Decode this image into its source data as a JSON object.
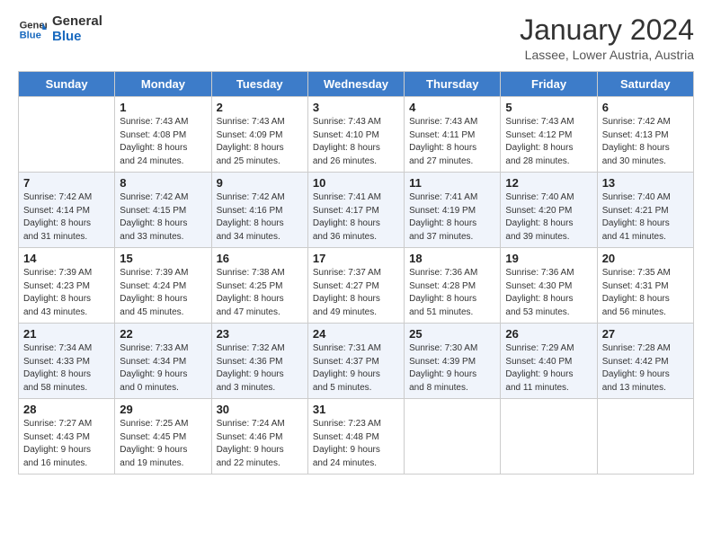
{
  "logo": {
    "line1": "General",
    "line2": "Blue"
  },
  "header": {
    "month": "January 2024",
    "location": "Lassee, Lower Austria, Austria"
  },
  "weekdays": [
    "Sunday",
    "Monday",
    "Tuesday",
    "Wednesday",
    "Thursday",
    "Friday",
    "Saturday"
  ],
  "weeks": [
    [
      {
        "day": "",
        "info": ""
      },
      {
        "day": "1",
        "info": "Sunrise: 7:43 AM\nSunset: 4:08 PM\nDaylight: 8 hours\nand 24 minutes."
      },
      {
        "day": "2",
        "info": "Sunrise: 7:43 AM\nSunset: 4:09 PM\nDaylight: 8 hours\nand 25 minutes."
      },
      {
        "day": "3",
        "info": "Sunrise: 7:43 AM\nSunset: 4:10 PM\nDaylight: 8 hours\nand 26 minutes."
      },
      {
        "day": "4",
        "info": "Sunrise: 7:43 AM\nSunset: 4:11 PM\nDaylight: 8 hours\nand 27 minutes."
      },
      {
        "day": "5",
        "info": "Sunrise: 7:43 AM\nSunset: 4:12 PM\nDaylight: 8 hours\nand 28 minutes."
      },
      {
        "day": "6",
        "info": "Sunrise: 7:42 AM\nSunset: 4:13 PM\nDaylight: 8 hours\nand 30 minutes."
      }
    ],
    [
      {
        "day": "7",
        "info": "Sunrise: 7:42 AM\nSunset: 4:14 PM\nDaylight: 8 hours\nand 31 minutes."
      },
      {
        "day": "8",
        "info": "Sunrise: 7:42 AM\nSunset: 4:15 PM\nDaylight: 8 hours\nand 33 minutes."
      },
      {
        "day": "9",
        "info": "Sunrise: 7:42 AM\nSunset: 4:16 PM\nDaylight: 8 hours\nand 34 minutes."
      },
      {
        "day": "10",
        "info": "Sunrise: 7:41 AM\nSunset: 4:17 PM\nDaylight: 8 hours\nand 36 minutes."
      },
      {
        "day": "11",
        "info": "Sunrise: 7:41 AM\nSunset: 4:19 PM\nDaylight: 8 hours\nand 37 minutes."
      },
      {
        "day": "12",
        "info": "Sunrise: 7:40 AM\nSunset: 4:20 PM\nDaylight: 8 hours\nand 39 minutes."
      },
      {
        "day": "13",
        "info": "Sunrise: 7:40 AM\nSunset: 4:21 PM\nDaylight: 8 hours\nand 41 minutes."
      }
    ],
    [
      {
        "day": "14",
        "info": "Sunrise: 7:39 AM\nSunset: 4:23 PM\nDaylight: 8 hours\nand 43 minutes."
      },
      {
        "day": "15",
        "info": "Sunrise: 7:39 AM\nSunset: 4:24 PM\nDaylight: 8 hours\nand 45 minutes."
      },
      {
        "day": "16",
        "info": "Sunrise: 7:38 AM\nSunset: 4:25 PM\nDaylight: 8 hours\nand 47 minutes."
      },
      {
        "day": "17",
        "info": "Sunrise: 7:37 AM\nSunset: 4:27 PM\nDaylight: 8 hours\nand 49 minutes."
      },
      {
        "day": "18",
        "info": "Sunrise: 7:36 AM\nSunset: 4:28 PM\nDaylight: 8 hours\nand 51 minutes."
      },
      {
        "day": "19",
        "info": "Sunrise: 7:36 AM\nSunset: 4:30 PM\nDaylight: 8 hours\nand 53 minutes."
      },
      {
        "day": "20",
        "info": "Sunrise: 7:35 AM\nSunset: 4:31 PM\nDaylight: 8 hours\nand 56 minutes."
      }
    ],
    [
      {
        "day": "21",
        "info": "Sunrise: 7:34 AM\nSunset: 4:33 PM\nDaylight: 8 hours\nand 58 minutes."
      },
      {
        "day": "22",
        "info": "Sunrise: 7:33 AM\nSunset: 4:34 PM\nDaylight: 9 hours\nand 0 minutes."
      },
      {
        "day": "23",
        "info": "Sunrise: 7:32 AM\nSunset: 4:36 PM\nDaylight: 9 hours\nand 3 minutes."
      },
      {
        "day": "24",
        "info": "Sunrise: 7:31 AM\nSunset: 4:37 PM\nDaylight: 9 hours\nand 5 minutes."
      },
      {
        "day": "25",
        "info": "Sunrise: 7:30 AM\nSunset: 4:39 PM\nDaylight: 9 hours\nand 8 minutes."
      },
      {
        "day": "26",
        "info": "Sunrise: 7:29 AM\nSunset: 4:40 PM\nDaylight: 9 hours\nand 11 minutes."
      },
      {
        "day": "27",
        "info": "Sunrise: 7:28 AM\nSunset: 4:42 PM\nDaylight: 9 hours\nand 13 minutes."
      }
    ],
    [
      {
        "day": "28",
        "info": "Sunrise: 7:27 AM\nSunset: 4:43 PM\nDaylight: 9 hours\nand 16 minutes."
      },
      {
        "day": "29",
        "info": "Sunrise: 7:25 AM\nSunset: 4:45 PM\nDaylight: 9 hours\nand 19 minutes."
      },
      {
        "day": "30",
        "info": "Sunrise: 7:24 AM\nSunset: 4:46 PM\nDaylight: 9 hours\nand 22 minutes."
      },
      {
        "day": "31",
        "info": "Sunrise: 7:23 AM\nSunset: 4:48 PM\nDaylight: 9 hours\nand 24 minutes."
      },
      {
        "day": "",
        "info": ""
      },
      {
        "day": "",
        "info": ""
      },
      {
        "day": "",
        "info": ""
      }
    ]
  ]
}
